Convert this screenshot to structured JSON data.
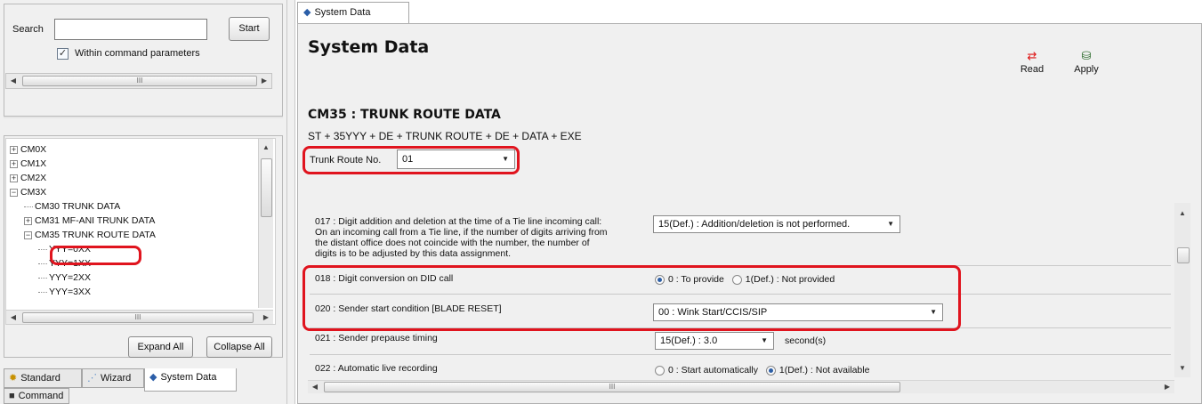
{
  "search": {
    "label": "Search",
    "value": "",
    "start_label": "Start",
    "within_label": "Within command parameters",
    "within_checked": true
  },
  "scroll_glyph": "III",
  "tree": {
    "items": [
      {
        "label": "CM0X",
        "expander": "+"
      },
      {
        "label": "CM1X",
        "expander": "+"
      },
      {
        "label": "CM2X",
        "expander": "+"
      },
      {
        "label": "CM3X",
        "expander": "−"
      },
      {
        "label": "CM30 TRUNK DATA"
      },
      {
        "label": "CM31 MF-ANI TRUNK DATA",
        "expander": "+"
      },
      {
        "label": "CM35 TRUNK ROUTE DATA",
        "expander": "−"
      },
      {
        "label": "YYY=0XX"
      },
      {
        "label": "YYY=1XX"
      },
      {
        "label": "YYY=2XX"
      },
      {
        "label": "YYY=3XX"
      }
    ],
    "expand_all": "Expand All",
    "collapse_all": "Collapse All"
  },
  "bottom_tabs": {
    "standard": "Standard",
    "wizard": "Wizard",
    "system_data": "System Data",
    "command": "Command"
  },
  "top_tab": "System Data",
  "page_title": "System Data",
  "toolbar": {
    "read": "Read",
    "apply": "Apply"
  },
  "section_title": "CM35 : TRUNK ROUTE DATA",
  "command_syntax": "ST + 35YYY + DE + TRUNK ROUTE + DE + DATA + EXE",
  "trunk_route": {
    "label": "Trunk Route No.",
    "value": "01"
  },
  "rows": {
    "r017": {
      "line1": "017 : Digit addition and deletion at the time of a Tie line incoming call:",
      "line2": "On an incoming call from a Tie line, if the number of digits arriving from",
      "line3": "the distant office does not coincide with the number, the number of",
      "line4": "digits is to be adjusted by this data assignment.",
      "value": "15(Def.) : Addition/deletion is not performed."
    },
    "r018": {
      "label": "018 : Digit conversion on DID call",
      "opt1": "0 : To provide",
      "opt2": "1(Def.) : Not provided",
      "selected": "opt1"
    },
    "r020": {
      "label": "020 : Sender start condition [BLADE RESET]",
      "value": "00 : Wink Start/CCIS/SIP"
    },
    "r021": {
      "label": "021 : Sender prepause timing",
      "value": "15(Def.) : 3.0",
      "unit": "second(s)"
    },
    "r022": {
      "label": "022 : Automatic live recording",
      "opt1": "0 : Start automatically",
      "opt2": "1(Def.) : Not available",
      "selected": "opt2"
    }
  },
  "colors": {
    "highlight": "#e0141e",
    "panel": "#f0f0f0",
    "radio_dot": "#2d5fa6"
  }
}
